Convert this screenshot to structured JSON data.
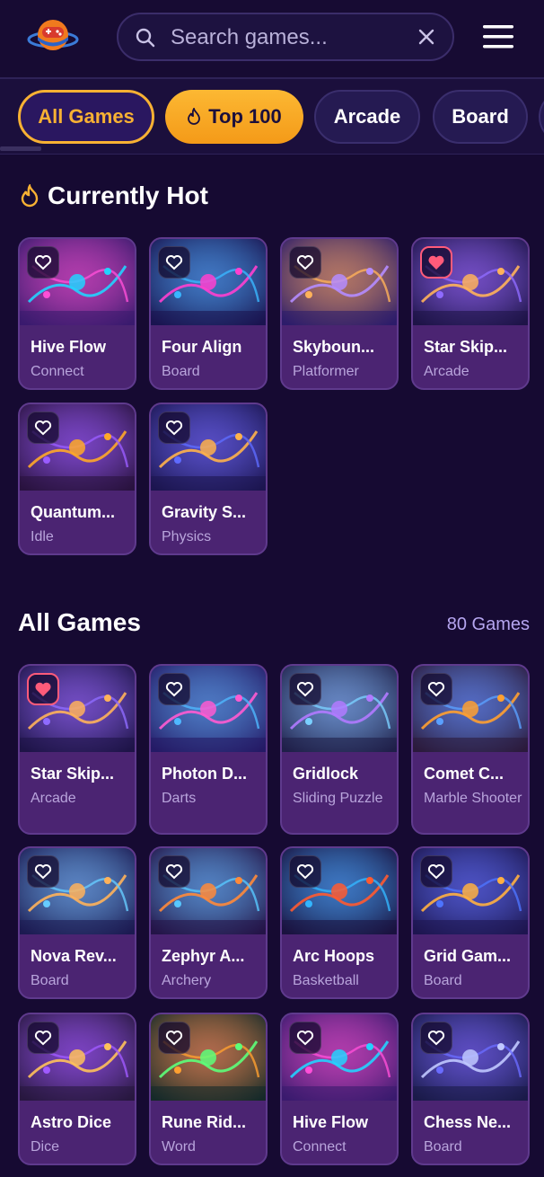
{
  "header": {
    "search_placeholder": "Search games..."
  },
  "tabs": [
    "All Games",
    "Top 100",
    "Arcade",
    "Board"
  ],
  "hot": {
    "title": "Currently Hot",
    "games": [
      {
        "title": "Hive Flow",
        "category": "Connect",
        "favorite": false
      },
      {
        "title": "Four Align",
        "category": "Board",
        "favorite": false
      },
      {
        "title": "Skyboun...",
        "category": "Platformer",
        "favorite": false
      },
      {
        "title": "Star Skip...",
        "category": "Arcade",
        "favorite": true
      },
      {
        "title": "Quantum...",
        "category": "Idle",
        "favorite": false
      },
      {
        "title": "Gravity S...",
        "category": "Physics",
        "favorite": false
      }
    ]
  },
  "all": {
    "title": "All Games",
    "count": "80 Games",
    "games": [
      {
        "title": "Star Skip...",
        "category": "Arcade",
        "favorite": true
      },
      {
        "title": "Photon D...",
        "category": "Darts",
        "favorite": false
      },
      {
        "title": "Gridlock",
        "category": "Sliding Puzzle",
        "favorite": false
      },
      {
        "title": "Comet C...",
        "category": "Marble Shooter",
        "favorite": false
      },
      {
        "title": "Nova Rev...",
        "category": "Board",
        "favorite": false
      },
      {
        "title": "Zephyr A...",
        "category": "Archery",
        "favorite": false
      },
      {
        "title": "Arc Hoops",
        "category": "Basketball",
        "favorite": false
      },
      {
        "title": "Grid Gam...",
        "category": "Board",
        "favorite": false
      },
      {
        "title": "Astro Dice",
        "category": "Dice",
        "favorite": false
      },
      {
        "title": "Rune Rid...",
        "category": "Word",
        "favorite": false
      },
      {
        "title": "Hive Flow",
        "category": "Connect",
        "favorite": false
      },
      {
        "title": "Chess Ne...",
        "category": "Board",
        "favorite": false
      }
    ]
  },
  "colors": {
    "accent": "#f8b133",
    "background": "#160a32",
    "card": "#4b2472",
    "favorite": "#ff5b7a"
  }
}
